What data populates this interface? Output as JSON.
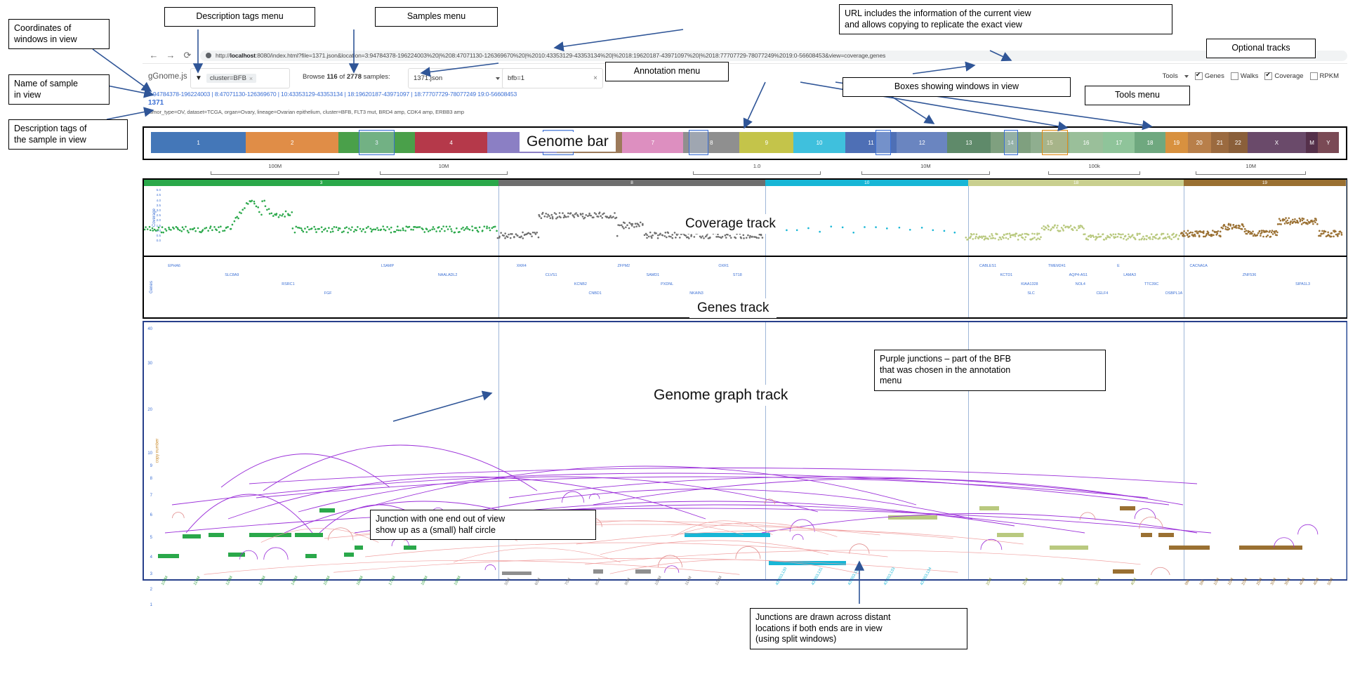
{
  "browser": {
    "back_icon": "back-arrow-icon",
    "forward_icon": "forward-arrow-icon",
    "reload_icon": "reload-icon",
    "url_prefix": "http://",
    "url_host": "localhost",
    "url_rest": ":8080/index.html?file=1371.json&location=3:94784378-196224003%20|%208:47071130-126369670%20|%2010:43353129-43353134%20|%2018:19620187-43971097%20|%2018:77707729-78077249%2019:0-56608453&view=coverage,genes"
  },
  "header": {
    "brand": "gGnome.js",
    "filter_icon": "funnel-icon",
    "filter_chip": "cluster=BFB",
    "filter_chip_remove": "×",
    "browse_prefix": "Browse ",
    "browse_count": "116",
    "browse_mid": " of ",
    "browse_total": "2778",
    "browse_suffix": " samples:",
    "sample_select_value": "1371.json",
    "sample_select_caret": "chevron-down-icon",
    "annotation_value": "bfb=1",
    "annotation_clear": "×",
    "coordinates": "3:94784378-196224003 | 8:47071130-126369670 | 10:43353129-43353134 | 18:19620187-43971097 | 18:77707729-78077249 19:0-56608453",
    "sample_name": "1371",
    "tags": "tumor_type=OV, dataset=TCGA, organ=Ovary, lineage=Ovarian epithelium, cluster=BFB, FLT3 mut, BRD4 amp, CDK4 amp, ERBB3 amp",
    "tools_label": "Tools",
    "tools_caret": "chevron-down-icon",
    "toggles": [
      {
        "label": "Genes",
        "checked": true
      },
      {
        "label": "Walks",
        "checked": false
      },
      {
        "label": "Coverage",
        "checked": true
      },
      {
        "label": "RPKM",
        "checked": false
      }
    ]
  },
  "genome_bar": {
    "caption": "Genome bar",
    "chromosomes": [
      {
        "label": "1",
        "color": "#4477b8",
        "w": 8.1
      },
      {
        "label": "2",
        "color": "#e08d47",
        "w": 7.9
      },
      {
        "label": "3",
        "color": "#4aa04a",
        "w": 6.5
      },
      {
        "label": "4",
        "color": "#b5394a",
        "w": 6.2
      },
      {
        "label": "5",
        "color": "#8b7fc4",
        "w": 5.9
      },
      {
        "label": "6",
        "color": "#9c7a5a",
        "w": 5.6
      },
      {
        "label": "7",
        "color": "#dd8fc0",
        "w": 5.2
      },
      {
        "label": "8",
        "color": "#8f8f8f",
        "w": 4.8
      },
      {
        "label": "9",
        "color": "#c4c44a",
        "w": 4.6
      },
      {
        "label": "10",
        "color": "#3fc0dd",
        "w": 4.4
      },
      {
        "label": "11",
        "color": "#4e6fb5",
        "w": 4.4
      },
      {
        "label": "12",
        "color": "#6a85c0",
        "w": 4.3
      },
      {
        "label": "13",
        "color": "#5f8a6a",
        "w": 3.7
      },
      {
        "label": "14",
        "color": "#7fa07f",
        "w": 3.4
      },
      {
        "label": "15",
        "color": "#8fae8f",
        "w": 3.3
      },
      {
        "label": "16",
        "color": "#9abf9a",
        "w": 2.9
      },
      {
        "label": "17",
        "color": "#8fc49a",
        "w": 2.7
      },
      {
        "label": "18",
        "color": "#6fa87f",
        "w": 2.6
      },
      {
        "label": "19",
        "color": "#d8913f",
        "w": 1.9
      },
      {
        "label": "20",
        "color": "#b87f4a",
        "w": 2.0
      },
      {
        "label": "21",
        "color": "#9b6a3f",
        "w": 1.5
      },
      {
        "label": "22",
        "color": "#8a5f3a",
        "w": 1.6
      },
      {
        "label": "X",
        "color": "#6a4a6a",
        "w": 5.0
      },
      {
        "label": "M",
        "color": "#55304a",
        "w": 1.0
      },
      {
        "label": "Y",
        "color": "#7a4a55",
        "w": 1.8
      }
    ]
  },
  "ruler": {
    "ticks": [
      "100M",
      "10M",
      "1.0",
      "10M",
      "100k",
      "10M"
    ]
  },
  "tracks": {
    "coverage": {
      "caption": "Coverage track",
      "ylabel": "Coverage",
      "yticks": [
        "5.5",
        "5.0",
        "4.5",
        "4.0",
        "3.5",
        "3.0",
        "2.5",
        "2.0",
        "1.5",
        "1.0",
        "0.5",
        "0.0"
      ]
    },
    "genes": {
      "caption": "Genes track",
      "ylabel": "Genes",
      "labels_w1": [
        "EPHA6",
        "SLC8A9",
        "RSRC1",
        "FGF",
        "LSAMP",
        "NAALADL2"
      ],
      "labels_w2": [
        "XKR4",
        "CLVS1",
        "KCNB2",
        "CNBD1",
        "ZFPM2",
        "SAMD1",
        "PXDNL",
        "NKAIN3",
        "OXR1",
        "ST18"
      ],
      "labels_w4": [
        "CABLES1",
        "KCTD1",
        "KIAA1328",
        "SLC",
        "TMEM241",
        "AQP4-AS1",
        "NOL4",
        "CELF4",
        "E",
        "LAMA3",
        "TTC39C",
        "OSBPL1A"
      ],
      "labels_w5": [
        "CACNA1A",
        "ZNF536",
        "SIPA1L3"
      ]
    },
    "graph": {
      "caption": "Genome graph track",
      "ylabel": "copy number",
      "yticks": [
        "40",
        "30",
        "20",
        "10",
        "9",
        "8",
        "7",
        "6",
        "5",
        "4",
        "3",
        "2",
        "1"
      ]
    },
    "windows": [
      {
        "label": "3",
        "color": "#2aa84a",
        "start": 0,
        "width": 29.5
      },
      {
        "label": "8",
        "color": "#6e6e6e",
        "start": 29.5,
        "width": 22.2
      },
      {
        "label": "10",
        "color": "#17b6d6",
        "start": 51.7,
        "width": 16.9
      },
      {
        "label": "18",
        "color": "#c9cf8f",
        "start": 68.6,
        "width": 17.9
      },
      {
        "label": "19",
        "color": "#9a7032",
        "start": 86.5,
        "width": 13.5
      }
    ],
    "xticks_w1": [
      "100M",
      "110M",
      "120M",
      "130M",
      "140M",
      "150M",
      "160M",
      "170M",
      "180M",
      "190M"
    ],
    "xticks_w2": [
      "50M",
      "60M",
      "70M",
      "80M",
      "90M",
      "100M",
      "110M",
      "120M"
    ],
    "xticks_w3": [
      "43,353,130",
      "43,353,131",
      "43,353,132",
      "43,353,133",
      "43,353,134"
    ],
    "xticks_w4": [
      "20M",
      "25M",
      "30M",
      "35M",
      "40M"
    ],
    "xticks_w5": [
      "0M",
      "5M",
      "10M",
      "15M",
      "20M",
      "25M",
      "30M",
      "35M",
      "40M",
      "45M",
      "50M"
    ]
  },
  "annotations": {
    "coords_in_view": "Coordinates of\nwindows in view",
    "sample_name_note": "Name of sample\nin view",
    "tags_note": "Description tags of\nthe sample in view",
    "desc_tags_menu": "Description tags menu",
    "samples_menu": "Samples menu",
    "annotation_menu": "Annotation menu",
    "url_note": "URL includes the information of the current view\nand allows copying to replicate the exact view",
    "optional_tracks": "Optional tracks",
    "boxes_note": "Boxes showing windows in view",
    "tools_menu": "Tools menu",
    "purple_junctions": "Purple junctions – part of the BFB\nthat was chosen in the annotation\nmenu",
    "half_circle": "Junction with one end out of view\nshow up as a (small) half circle",
    "distant_junctions": "Junctions are drawn across distant\nlocations if both ends are in view\n(using split windows)"
  }
}
